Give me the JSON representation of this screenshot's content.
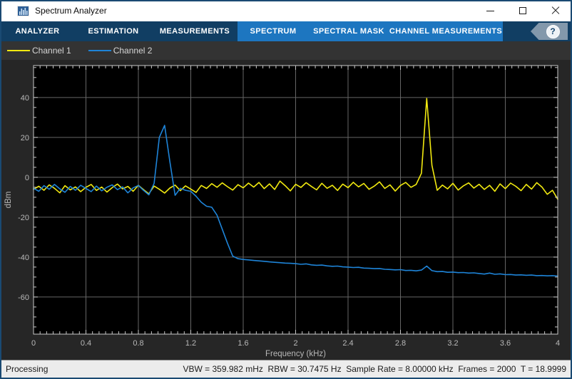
{
  "window": {
    "title": "Spectrum Analyzer",
    "controls": {
      "minimize": "minimize",
      "maximize": "maximize",
      "close": "close"
    }
  },
  "toolbar": {
    "tabs": [
      "ANALYZER",
      "ESTIMATION",
      "MEASUREMENTS"
    ],
    "active_tabs": [
      "SPECTRUM",
      "SPECTRAL MASK",
      "CHANNEL MEASUREMENTS"
    ],
    "help_label": "?"
  },
  "legend": {
    "items": [
      {
        "label": "Channel 1",
        "color": "#f2ea10"
      },
      {
        "label": "Channel 2",
        "color": "#1e84d8"
      }
    ]
  },
  "status_bar": {
    "left": "Processing",
    "right": "VBW = 359.982 mHz  RBW = 30.7475 Hz  Sample Rate = 8.00000 kHz  Frames = 2000  T = 18.9999"
  },
  "chart_data": {
    "type": "line",
    "title": "",
    "xlabel": "Frequency (kHz)",
    "ylabel": "dBm",
    "xlim": [
      0,
      4
    ],
    "ylim": [
      -78.6,
      56
    ],
    "grid": true,
    "background": "#000000",
    "grid_color": "#666666",
    "axis_color": "#c8c8c8",
    "label_color": "#b8b8b8",
    "xticks": [
      0,
      0.4,
      0.8,
      1.2,
      1.6,
      2,
      2.4,
      2.8,
      3.2,
      3.6,
      4
    ],
    "xtick_labels": [
      "0",
      "0.4",
      "0.8",
      "1.2",
      "1.6",
      "2",
      "2.4",
      "2.8",
      "3.2",
      "3.6",
      "4"
    ],
    "yticks": [
      40,
      20,
      0,
      -20,
      -40,
      -60
    ],
    "ytick_labels": [
      "40",
      "20",
      "0",
      "-20",
      "-40",
      "-60"
    ],
    "x_minor_step": 0.05,
    "y_minor_step": 5,
    "legend_position": "top-bar",
    "x_start": 0,
    "x_step": 0.04,
    "series": [
      {
        "name": "Channel 1",
        "color": "#f2ea10",
        "values": [
          -6,
          -4.5,
          -6.5,
          -3.8,
          -5.5,
          -7.8,
          -4.2,
          -6.3,
          -4.8,
          -7.2,
          -5,
          -3.6,
          -6.6,
          -4.9,
          -7.4,
          -5.2,
          -3.4,
          -5.8,
          -4.6,
          -7,
          -4,
          -6.2,
          -8.3,
          -4.4,
          -6,
          -7.9,
          -5.4,
          -3.9,
          -6.7,
          -4.3,
          -5.9,
          -7.6,
          -4.1,
          -5.6,
          -3.2,
          -5,
          -2.8,
          -4.7,
          -6.4,
          -3.7,
          -5.3,
          -2.9,
          -4.9,
          -2.6,
          -5.7,
          -3.3,
          -6.1,
          -1.9,
          -4.2,
          -6.8,
          -3.5,
          -5.1,
          -2.7,
          -4.6,
          -6.3,
          -3,
          -5.5,
          -4,
          -6.6,
          -3.4,
          -5.2,
          -2.5,
          -4.8,
          -3.1,
          -6,
          -4.4,
          -2.3,
          -5.6,
          -3.8,
          -6.9,
          -4.1,
          -2.6,
          -5,
          -3.6,
          2,
          39.5,
          6,
          -6.5,
          -3.9,
          -5.8,
          -3,
          -6.4,
          -4.3,
          -2.8,
          -5.4,
          -3.5,
          -6.1,
          -4,
          -7,
          -3.3,
          -5.7,
          -2.9,
          -4.5,
          -6.7,
          -3.6,
          -5.9,
          -2.7,
          -4.9,
          -8.5,
          -6.5,
          -11
        ]
      },
      {
        "name": "Channel 2",
        "color": "#1e84d8",
        "values": [
          -5.5,
          -7,
          -4.2,
          -6,
          -3.6,
          -5.8,
          -7.5,
          -4.6,
          -6.5,
          -4,
          -5.6,
          -7.2,
          -4.4,
          -6.8,
          -5,
          -3.8,
          -6.2,
          -4.8,
          -7.8,
          -5.3,
          -4.1,
          -6.6,
          -8.8,
          -3,
          20,
          26,
          8,
          -9,
          -5.5,
          -6.5,
          -7,
          -9.5,
          -12.5,
          -14.5,
          -15,
          -19,
          -26,
          -33,
          -39.5,
          -40.8,
          -41.2,
          -41.4,
          -41.7,
          -41.9,
          -42.1,
          -42.4,
          -42.6,
          -42.8,
          -43,
          -43.1,
          -43.3,
          -43.6,
          -43.4,
          -43.9,
          -44.1,
          -44,
          -44.4,
          -44.6,
          -44.5,
          -44.9,
          -45,
          -45.2,
          -45.1,
          -45.5,
          -45.6,
          -45.8,
          -45.7,
          -46.1,
          -46.2,
          -46.4,
          -46.3,
          -46.7,
          -46.6,
          -46.9,
          -46.5,
          -44.5,
          -46.8,
          -47.3,
          -47.2,
          -47.6,
          -47.5,
          -47.8,
          -47.7,
          -48,
          -47.9,
          -48.2,
          -48.5,
          -48,
          -48.6,
          -48.4,
          -48.8,
          -48.7,
          -49,
          -48.9,
          -49.1,
          -49,
          -49.3,
          -49.2,
          -49.4,
          -49.3,
          -49.5
        ]
      }
    ]
  }
}
